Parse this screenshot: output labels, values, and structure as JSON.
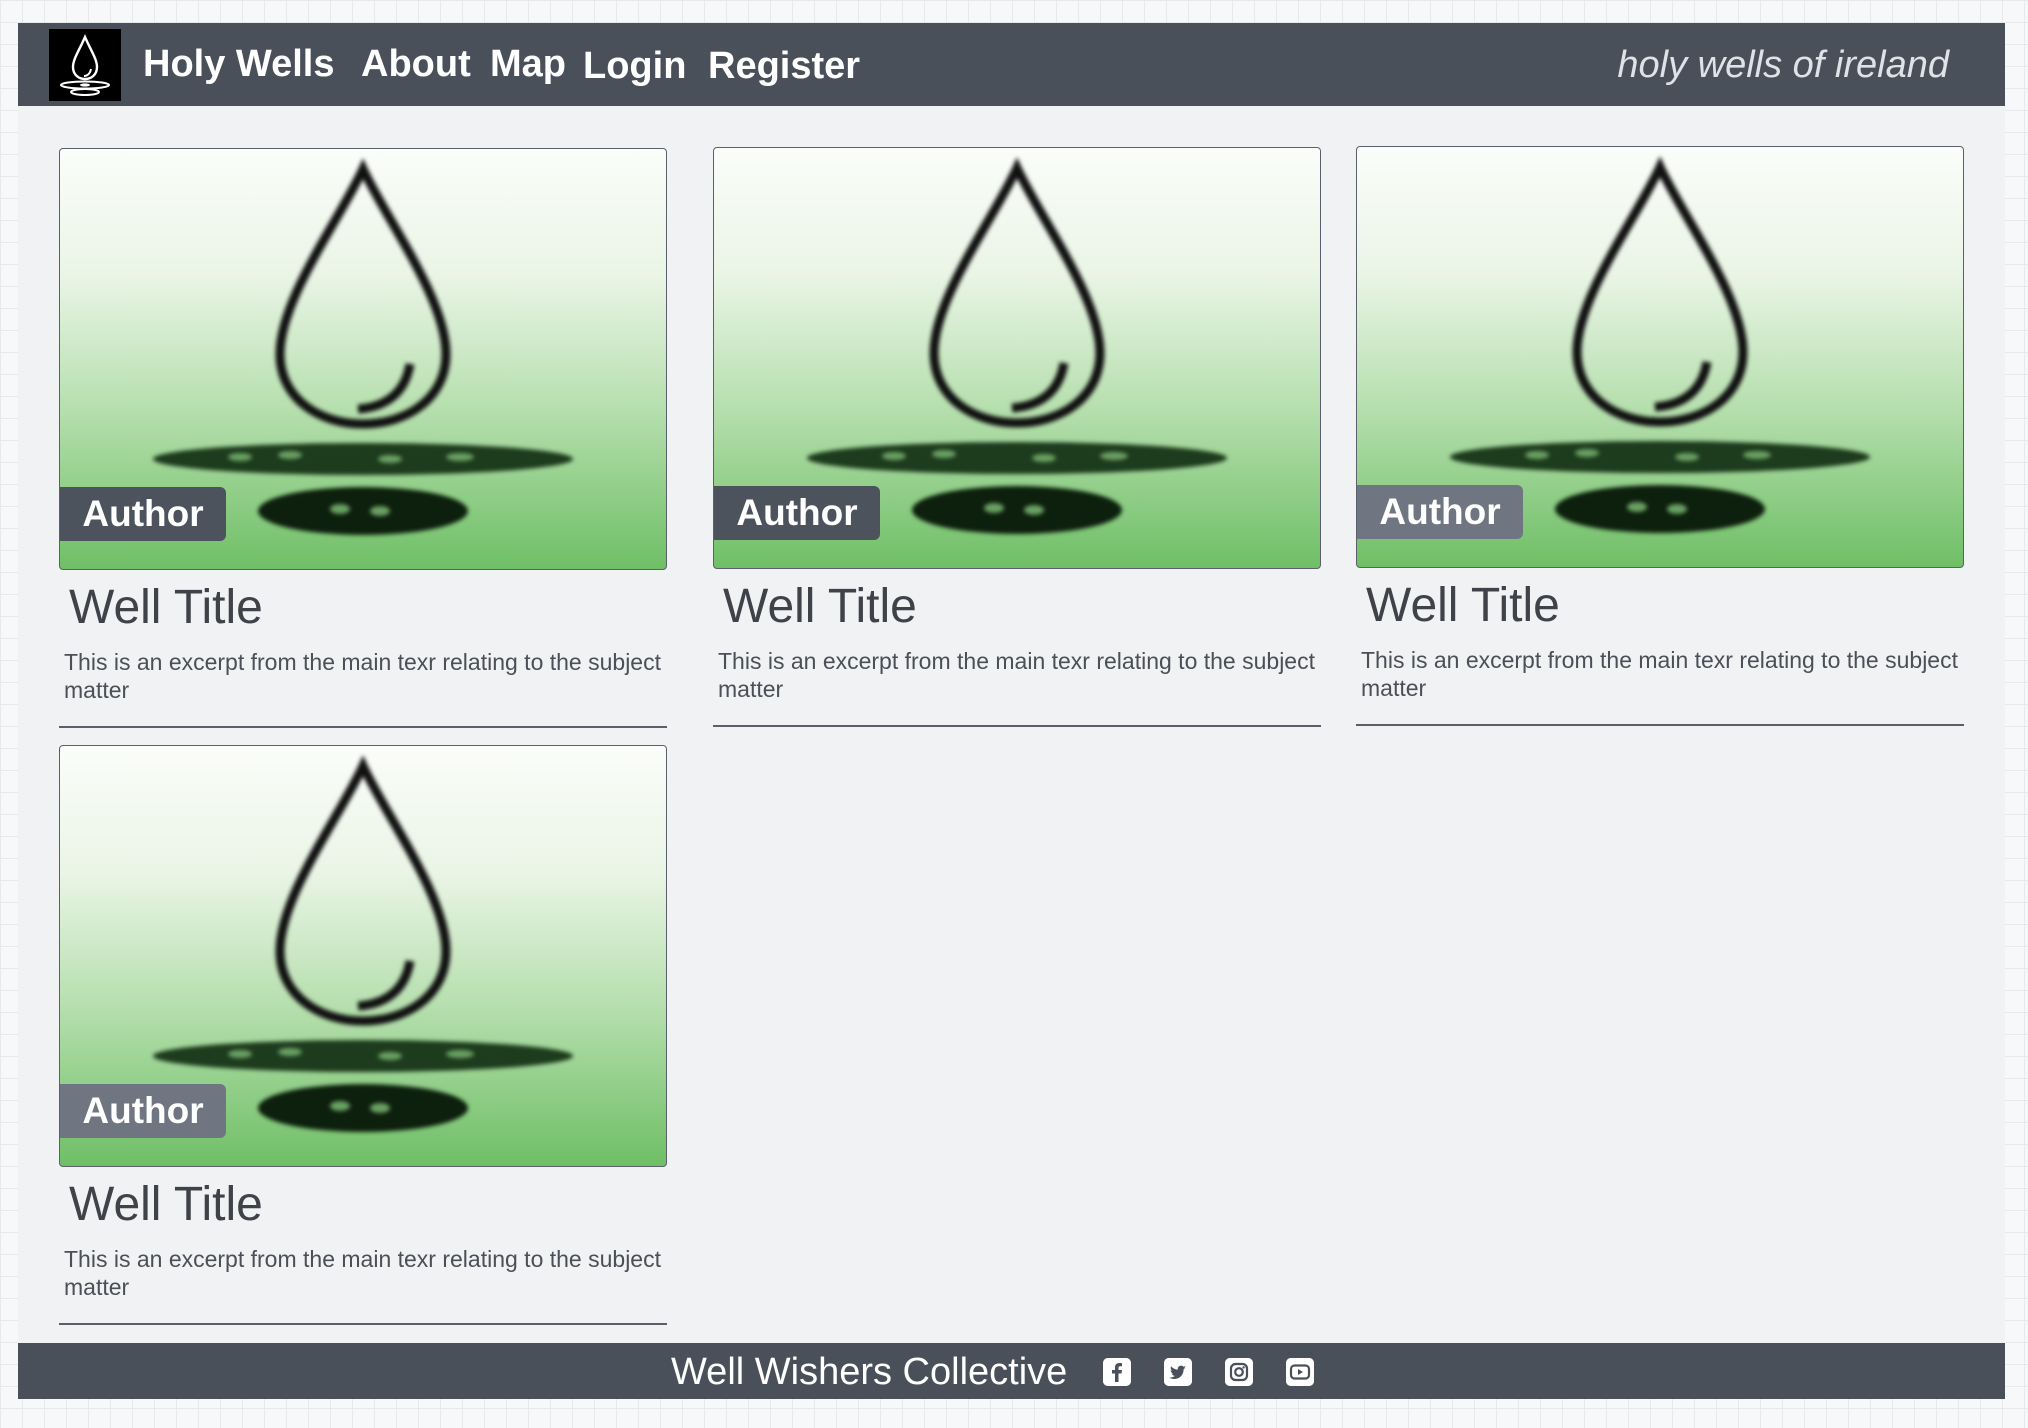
{
  "nav": {
    "brand": "Holy Wells",
    "items": [
      "About",
      "Map",
      "Login",
      "Register"
    ],
    "tagline": "holy wells of ireland",
    "logo_icon": "holy-well-logo-icon"
  },
  "cards": [
    {
      "badge": "Author",
      "title": "Well Title",
      "excerpt": "This is an excerpt from the main texr relating to the subject matter"
    },
    {
      "badge": "Author",
      "title": "Well Title",
      "excerpt": "This is an excerpt from the main texr relating to the subject matter"
    },
    {
      "badge": "Author",
      "title": "Well Title",
      "excerpt": "This is an excerpt from the main texr relating to the subject matter"
    },
    {
      "badge": "Author",
      "title": "Well Title",
      "excerpt": "This is an excerpt from the main texr relating to the subject matter"
    }
  ],
  "footer": {
    "text": "Well Wishers Collective",
    "social_icons": [
      "facebook-icon",
      "twitter-icon",
      "instagram-icon",
      "youtube-icon"
    ]
  },
  "colors": {
    "navbar": "#4a505a",
    "page_background": "#f1f2f4",
    "badge": "#4c535d",
    "image_gradient_top": "#fbfdfa",
    "image_gradient_bottom": "#6fbf66"
  }
}
